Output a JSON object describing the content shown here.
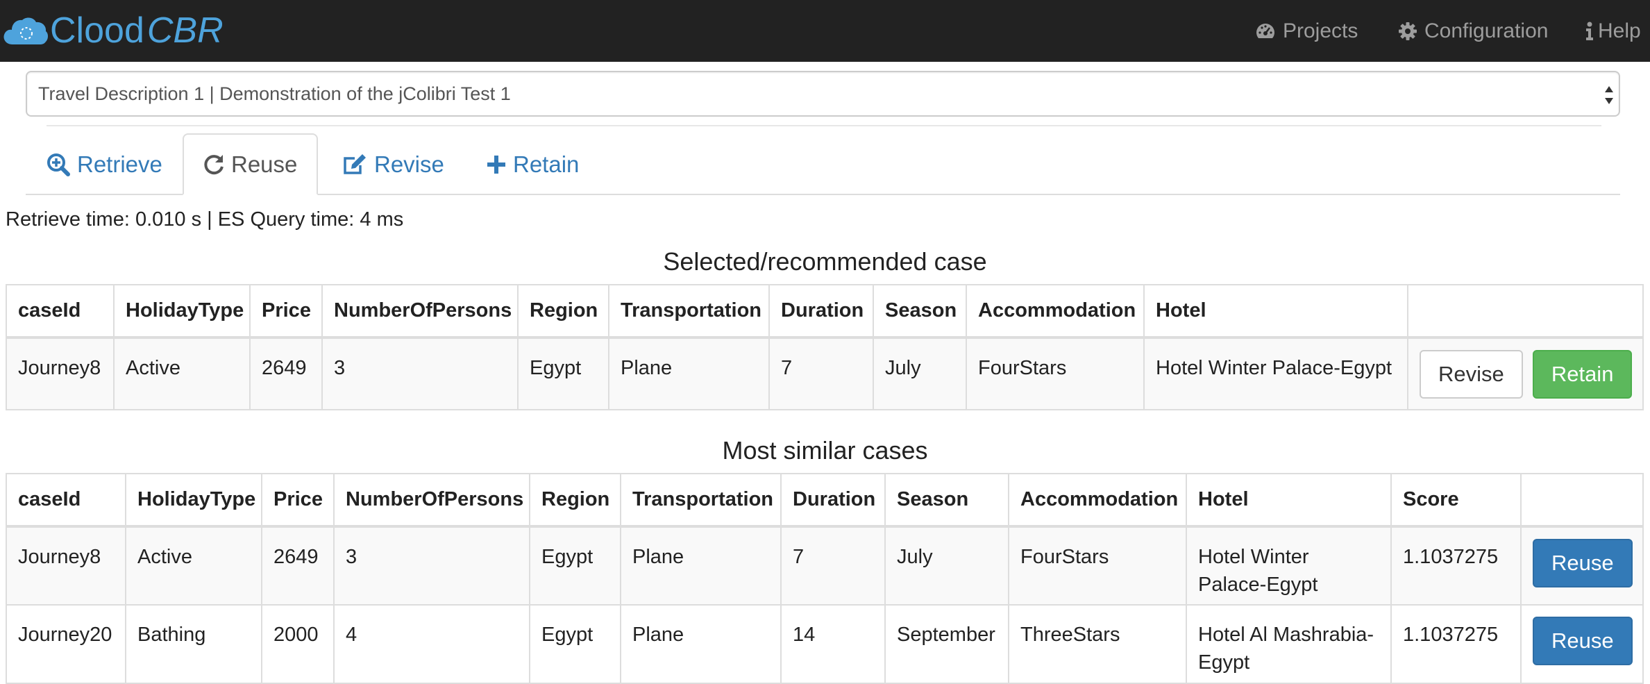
{
  "brand": {
    "name_part1": "Clood",
    "name_part2": "CBR",
    "color": "#4ea3dc"
  },
  "nav": {
    "projects": {
      "label": "Projects",
      "icon": "dashboard-icon"
    },
    "configuration": {
      "label": "Configuration",
      "icon": "gear-icon"
    },
    "help": {
      "label": "Help",
      "icon": "info-icon"
    }
  },
  "case_select": {
    "value": "Travel Description 1 | Demonstration of the jColibri Test 1"
  },
  "tabs": [
    {
      "label": "Retrieve",
      "icon": "search-plus-icon",
      "active": false
    },
    {
      "label": "Reuse",
      "icon": "refresh-icon",
      "active": true
    },
    {
      "label": "Revise",
      "icon": "edit-icon",
      "active": false
    },
    {
      "label": "Retain",
      "icon": "plus-icon",
      "active": false
    }
  ],
  "timing": "Retrieve time: 0.010 s | ES Query time: 4 ms",
  "selected": {
    "caption": "Selected/recommended case",
    "headers": [
      "caseId",
      "HolidayType",
      "Price",
      "NumberOfPersons",
      "Region",
      "Transportation",
      "Duration",
      "Season",
      "Accommodation",
      "Hotel",
      ""
    ],
    "row": [
      "Journey8",
      "Active",
      "2649",
      "3",
      "Egypt",
      "Plane",
      "7",
      "July",
      "FourStars",
      "Hotel Winter Palace-Egypt"
    ],
    "revise_label": "Revise",
    "retain_label": "Retain"
  },
  "similar": {
    "caption": "Most similar cases",
    "headers": [
      "caseId",
      "HolidayType",
      "Price",
      "NumberOfPersons",
      "Region",
      "Transportation",
      "Duration",
      "Season",
      "Accommodation",
      "Hotel",
      "Score",
      ""
    ],
    "rows": [
      [
        "Journey8",
        "Active",
        "2649",
        "3",
        "Egypt",
        "Plane",
        "7",
        "July",
        "FourStars",
        "Hotel Winter Palace-Egypt",
        "1.1037275"
      ],
      [
        "Journey20",
        "Bathing",
        "2000",
        "4",
        "Egypt",
        "Plane",
        "14",
        "September",
        "ThreeStars",
        "Hotel Al Mashrabia-Egypt",
        "1.1037275"
      ]
    ],
    "reuse_label": "Reuse"
  },
  "colors": {
    "navbar": "#222222",
    "link": "#337ab7",
    "success": "#5cb85c",
    "primary": "#337ab7"
  }
}
